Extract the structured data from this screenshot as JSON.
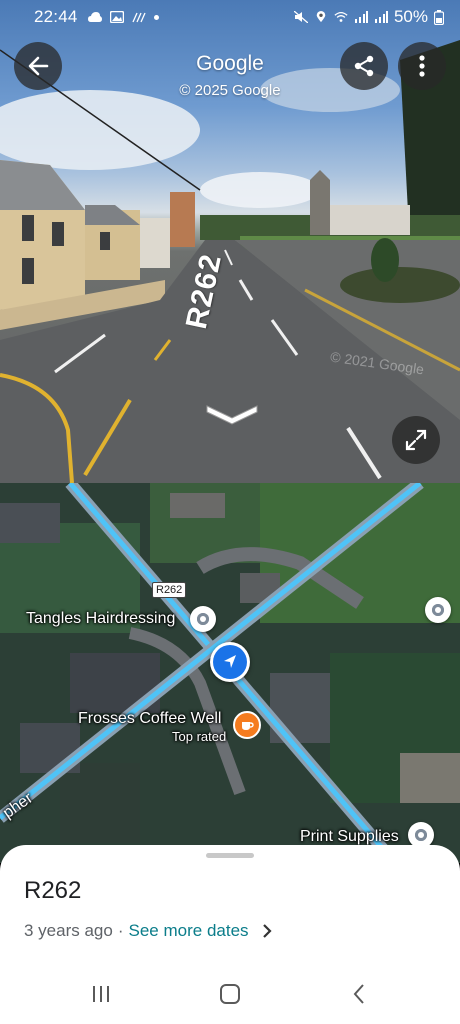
{
  "status_bar": {
    "time": "22:44",
    "battery": "50%",
    "left_icons": [
      "cloud-icon",
      "image-icon",
      "signal-pattern-icon",
      "dot-icon"
    ],
    "right_icons": [
      "mute-icon",
      "location-icon",
      "wifi-icon",
      "signal-icon",
      "signal-icon",
      "battery-icon"
    ]
  },
  "street_view": {
    "title": "Google",
    "copyright": "© 2025 Google",
    "road_label": "R262",
    "watermark": "© 2021 Google",
    "buttons": {
      "back": "back-arrow-icon",
      "share": "share-icon",
      "more": "more-vert-icon",
      "expand": "expand-icon",
      "navigate": "chevron-down-icon"
    }
  },
  "map": {
    "road_shield": "R262",
    "pois": [
      {
        "name": "Tangles Hairdressing"
      },
      {
        "name": "Frosses Coffee Well",
        "badge": "Top rated"
      },
      {
        "name": "Print Supplies"
      },
      {
        "name": "pher"
      }
    ],
    "route_color": "#4fc3f7",
    "location_color": "#1a73e8",
    "cafe_color": "#f57c1f"
  },
  "sheet": {
    "title": "R262",
    "age": "3 years ago",
    "separator": "·",
    "dates_link": "See more dates"
  },
  "system_nav": [
    "recents-icon",
    "home-icon",
    "back-icon"
  ]
}
